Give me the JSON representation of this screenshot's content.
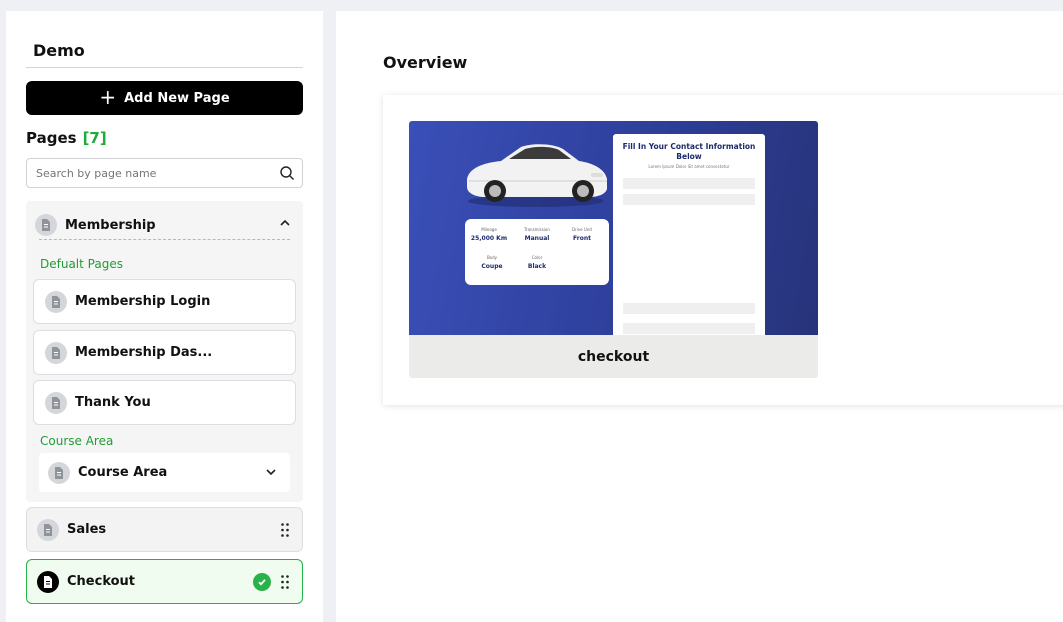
{
  "sidebar": {
    "title": "Demo",
    "add_button": "Add New Page",
    "pages_label": "Pages",
    "pages_count": "[7]",
    "search_placeholder": "Search by page name",
    "group": {
      "name": "Membership",
      "default_label": "Defualt Pages",
      "default_pages": [
        "Membership Login",
        "Membership Das...",
        "Thank You"
      ],
      "course_label": "Course Area",
      "course_item": "Course Area"
    },
    "rows": [
      "Sales",
      "Checkout"
    ]
  },
  "main": {
    "heading": "Overview",
    "thumb_label": "checkout",
    "preview": {
      "form_title": "Fill In Your Contact Information Below",
      "form_sub": "Lorem Ipsum Dolor Sit amet consectetur",
      "specs": [
        {
          "k": "Mileage",
          "v": "25,000 Km"
        },
        {
          "k": "Transmission",
          "v": "Manual"
        },
        {
          "k": "Drive Unit",
          "v": "Front"
        },
        {
          "k": "Body",
          "v": "Coupe"
        },
        {
          "k": "Color",
          "v": "Black"
        }
      ]
    }
  },
  "colors": {
    "accent_green": "#1faa3a",
    "button_black": "#000000",
    "preview_blue": "#3a4fb8"
  },
  "icons": [
    "plus-icon",
    "search-icon",
    "document-icon",
    "chevron-up-icon",
    "chevron-down-icon",
    "drag-handle-icon",
    "check-circle-icon",
    "car-image"
  ]
}
